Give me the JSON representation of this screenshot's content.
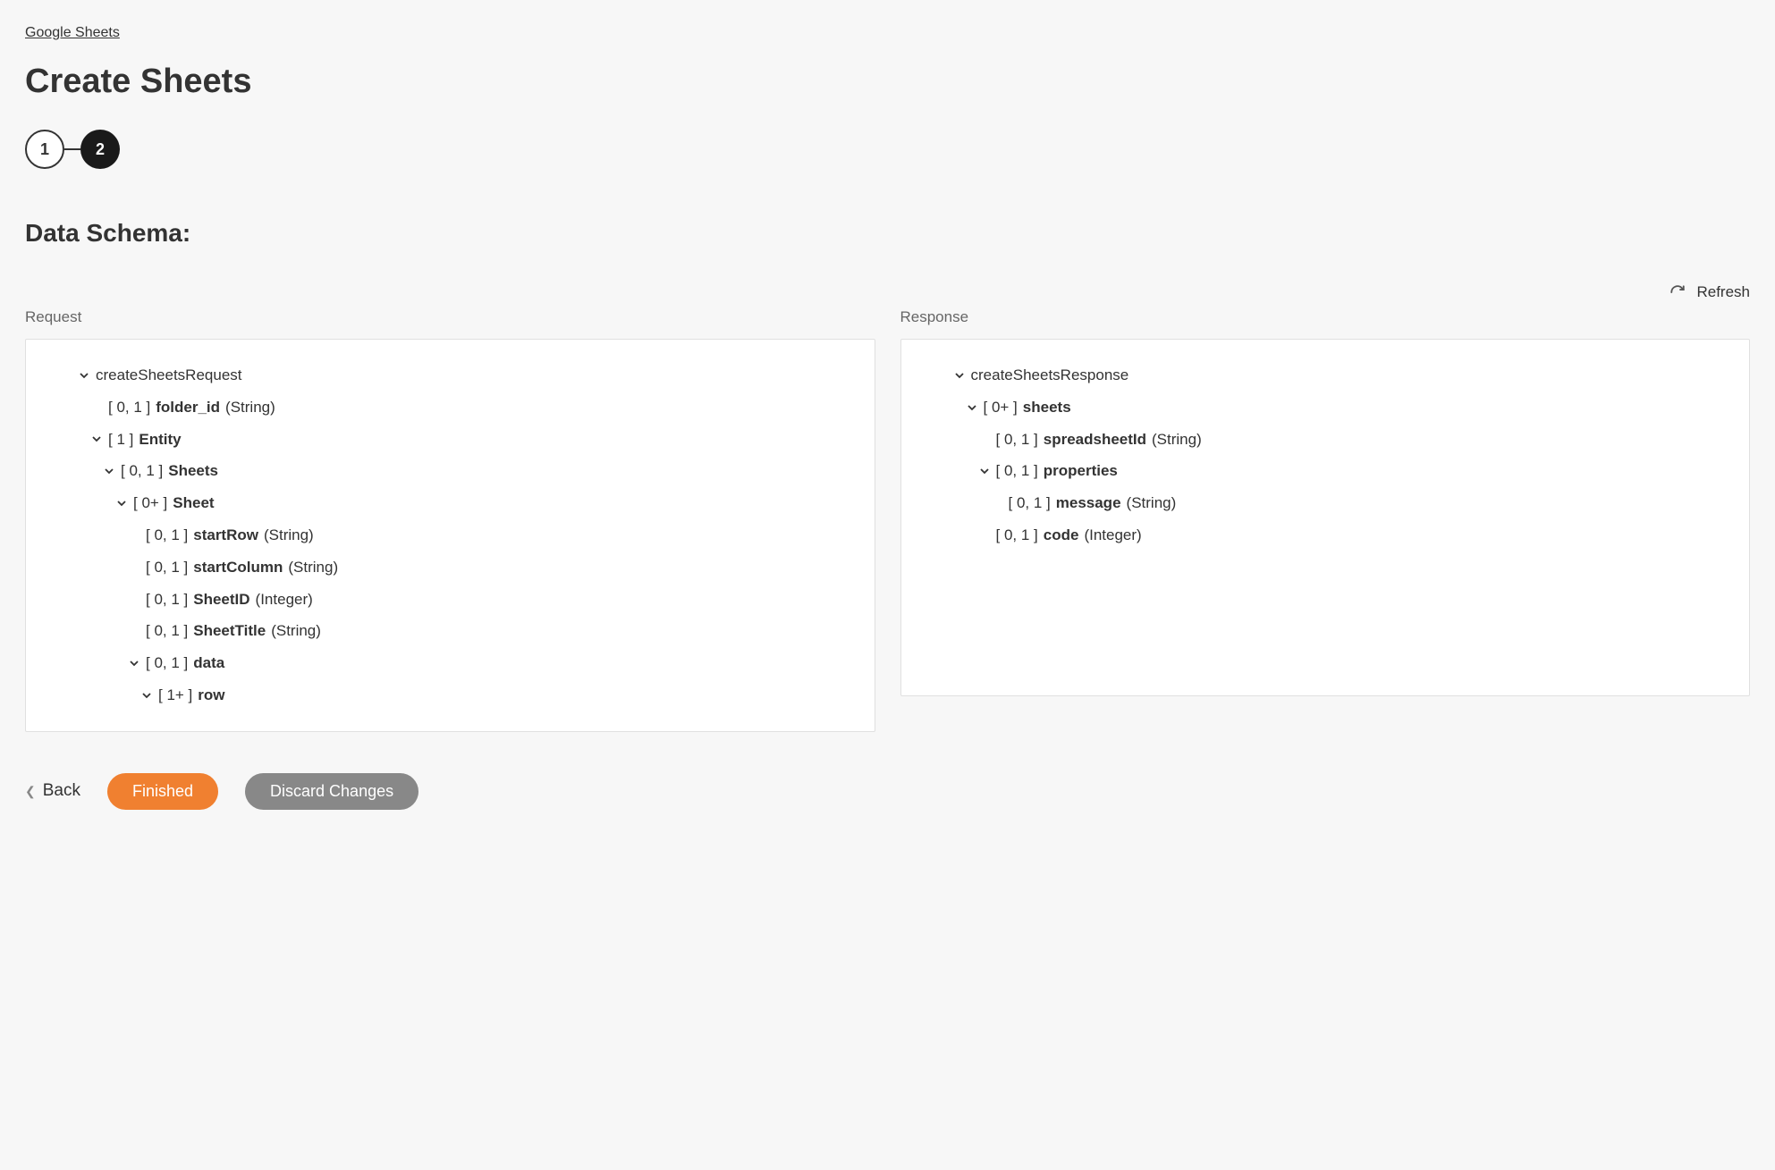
{
  "breadcrumb": "Google Sheets",
  "page_title": "Create Sheets",
  "stepper": {
    "step1": "1",
    "step2": "2"
  },
  "section_title": "Data Schema:",
  "refresh_label": "Refresh",
  "request_label": "Request",
  "response_label": "Response",
  "request_tree": {
    "root": "createSheetsRequest",
    "folder_id": {
      "card": "[ 0, 1 ]",
      "name": "folder_id",
      "type": "(String)"
    },
    "entity": {
      "card": "[ 1 ]",
      "name": "Entity"
    },
    "sheets": {
      "card": "[ 0, 1 ]",
      "name": "Sheets"
    },
    "sheet": {
      "card": "[ 0+ ]",
      "name": "Sheet"
    },
    "startRow": {
      "card": "[ 0, 1 ]",
      "name": "startRow",
      "type": "(String)"
    },
    "startColumn": {
      "card": "[ 0, 1 ]",
      "name": "startColumn",
      "type": "(String)"
    },
    "sheetID": {
      "card": "[ 0, 1 ]",
      "name": "SheetID",
      "type": "(Integer)"
    },
    "sheetTitle": {
      "card": "[ 0, 1 ]",
      "name": "SheetTitle",
      "type": "(String)"
    },
    "data": {
      "card": "[ 0, 1 ]",
      "name": "data"
    },
    "row": {
      "card": "[ 1+ ]",
      "name": "row"
    }
  },
  "response_tree": {
    "root": "createSheetsResponse",
    "sheets": {
      "card": "[ 0+ ]",
      "name": "sheets"
    },
    "spreadsheetId": {
      "card": "[ 0, 1 ]",
      "name": "spreadsheetId",
      "type": "(String)"
    },
    "properties": {
      "card": "[ 0, 1 ]",
      "name": "properties"
    },
    "message": {
      "card": "[ 0, 1 ]",
      "name": "message",
      "type": "(String)"
    },
    "code": {
      "card": "[ 0, 1 ]",
      "name": "code",
      "type": "(Integer)"
    }
  },
  "actions": {
    "back": "Back",
    "finished": "Finished",
    "discard": "Discard Changes"
  }
}
